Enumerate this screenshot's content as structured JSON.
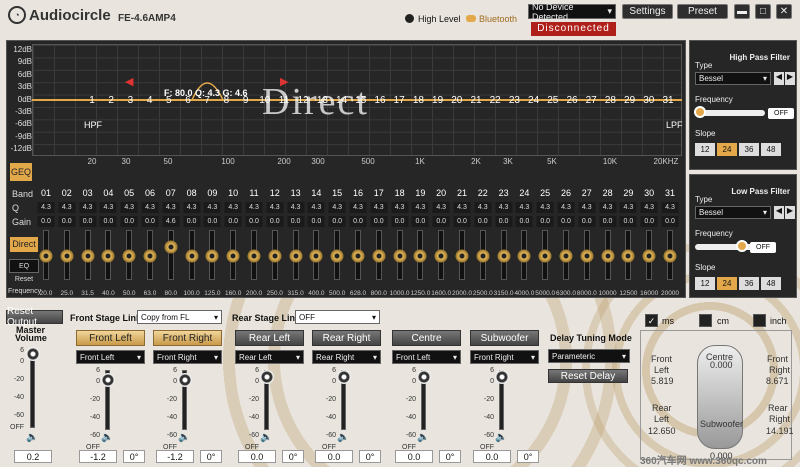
{
  "header": {
    "brand": "Audiocircle",
    "model": "FE-4.6AMP4",
    "legend_high": "High Level",
    "legend_bt": "Bluetooth",
    "device_select": "No Device Detected",
    "status": "Disconnected",
    "settings": "Settings",
    "preset": "Preset"
  },
  "graph": {
    "y_labels": [
      "12dB",
      "9dB",
      "6dB",
      "3dB",
      "0dB",
      "-3dB",
      "-6dB",
      "-9dB",
      "-12dB"
    ],
    "overlay": "Direct",
    "readout": "F: 80.0 Q: 4.3 G: 4.6",
    "hpf": "HPF",
    "lpf": "LPF",
    "freq_axis": [
      "20",
      "30",
      "50",
      "100",
      "200",
      "300",
      "500",
      "1K",
      "2K",
      "3K",
      "5K",
      "10K",
      "20KHZ"
    ],
    "band_labels": [
      "1",
      "2",
      "3",
      "4",
      "5",
      "6",
      "7",
      "8",
      "9",
      "10",
      "11",
      "12",
      "13",
      "14",
      "15",
      "16",
      "17",
      "18",
      "19",
      "20",
      "21",
      "22",
      "23",
      "24",
      "25",
      "26",
      "27",
      "28",
      "29",
      "30",
      "31"
    ]
  },
  "eq": {
    "geq": "GEQ",
    "row_band": "Band",
    "row_q": "Q",
    "row_gain": "Gain",
    "direct": "Direct",
    "eq_reset": "EQ Reset",
    "row_freq": "Frequency",
    "bands": [
      "01",
      "02",
      "03",
      "04",
      "05",
      "06",
      "07",
      "08",
      "09",
      "10",
      "11",
      "12",
      "13",
      "14",
      "15",
      "16",
      "17",
      "18",
      "19",
      "20",
      "21",
      "22",
      "23",
      "24",
      "25",
      "26",
      "27",
      "28",
      "29",
      "30",
      "31"
    ],
    "q": [
      "4.3",
      "4.3",
      "4.3",
      "4.3",
      "4.3",
      "4.3",
      "4.3",
      "4.3",
      "4.3",
      "4.3",
      "4.3",
      "4.3",
      "4.3",
      "4.3",
      "4.3",
      "4.3",
      "4.3",
      "4.3",
      "4.3",
      "4.3",
      "4.3",
      "4.3",
      "4.3",
      "4.3",
      "4.3",
      "4.3",
      "4.3",
      "4.3",
      "4.3",
      "4.3",
      "4.3"
    ],
    "gain": [
      "0.0",
      "0.0",
      "0.0",
      "0.0",
      "0.0",
      "0.0",
      "4.6",
      "0.0",
      "0.0",
      "0.0",
      "0.0",
      "0.0",
      "0.0",
      "0.0",
      "0.0",
      "0.0",
      "0.0",
      "0.0",
      "0.0",
      "0.0",
      "0.0",
      "0.0",
      "0.0",
      "0.0",
      "0.0",
      "0.0",
      "0.0",
      "0.0",
      "0.0",
      "0.0",
      "0.0"
    ],
    "freqs": [
      "20.0",
      "25.0",
      "31.5",
      "40.0",
      "50.0",
      "63.0",
      "80.0",
      "100.0",
      "125.0",
      "160.0",
      "200.0",
      "250.0",
      "315.0",
      "400.0",
      "500.0",
      "628.0",
      "800.0",
      "1000.0",
      "1250.0",
      "1600.0",
      "2000.0",
      "2500.0",
      "3150.0",
      "4000.0",
      "5000.0",
      "6300.0",
      "8000.0",
      "10000",
      "12500",
      "16000",
      "20000"
    ]
  },
  "hpf": {
    "title": "High Pass Filter",
    "type_label": "Type",
    "type": "Bessel",
    "freq_label": "Frequency",
    "off": "OFF",
    "slope_label": "Slope",
    "slopes": [
      "12",
      "24",
      "36",
      "48"
    ],
    "active_slope": "24"
  },
  "lpf": {
    "title": "Low Pass Filter",
    "type_label": "Type",
    "type": "Bessel",
    "freq_label": "Frequency",
    "off": "OFF",
    "slope_label": "Slope",
    "slopes": [
      "12",
      "24",
      "36",
      "48"
    ],
    "active_slope": "24"
  },
  "bottom": {
    "reset_output": "Reset Output",
    "master": "Master",
    "volume": "Volume",
    "master_val": "0.2",
    "front_link": "Front Stage Link",
    "front_link_val": "Copy from FL",
    "rear_link": "Rear Stage Link",
    "rear_link_val": "OFF",
    "scale": [
      "6",
      "0",
      "-20",
      "-40",
      "-60",
      "OFF"
    ],
    "channels": [
      {
        "name": "Front Left",
        "src": "Front Left",
        "val": "-1.2",
        "deg": "0°"
      },
      {
        "name": "Front Right",
        "src": "Front Right",
        "val": "-1.2",
        "deg": "0°"
      },
      {
        "name": "Rear Left",
        "src": "Rear Left",
        "val": "0.0",
        "deg": "0°"
      },
      {
        "name": "Rear Right",
        "src": "Rear Right",
        "val": "0.0",
        "deg": "0°"
      },
      {
        "name": "Centre",
        "src": "Front Left",
        "val": "0.0",
        "deg": "0°"
      },
      {
        "name": "Subwoofer",
        "src": "Front Right",
        "val": "0.0",
        "deg": "0°"
      }
    ]
  },
  "delay": {
    "title": "Delay Tuning Mode",
    "mode": "Parameteric",
    "reset": "Reset Delay",
    "ms": "ms",
    "cm": "cm",
    "inch": "inch",
    "front_left": "Front",
    "front_left2": "Left",
    "fl_val": "5.819",
    "centre": "Centre",
    "centre_val": "0.000",
    "front_right": "Front",
    "front_right2": "Right",
    "fr_val": "8.671",
    "rear_left": "Rear",
    "rear_left2": "Left",
    "rl_val": "12.650",
    "rear_right": "Rear",
    "rear_right2": "Right",
    "rr_val": "14.191",
    "sub": "Subwoofer",
    "sub_val": "0.000"
  },
  "watermark": "360汽车网 www.360qc.com"
}
